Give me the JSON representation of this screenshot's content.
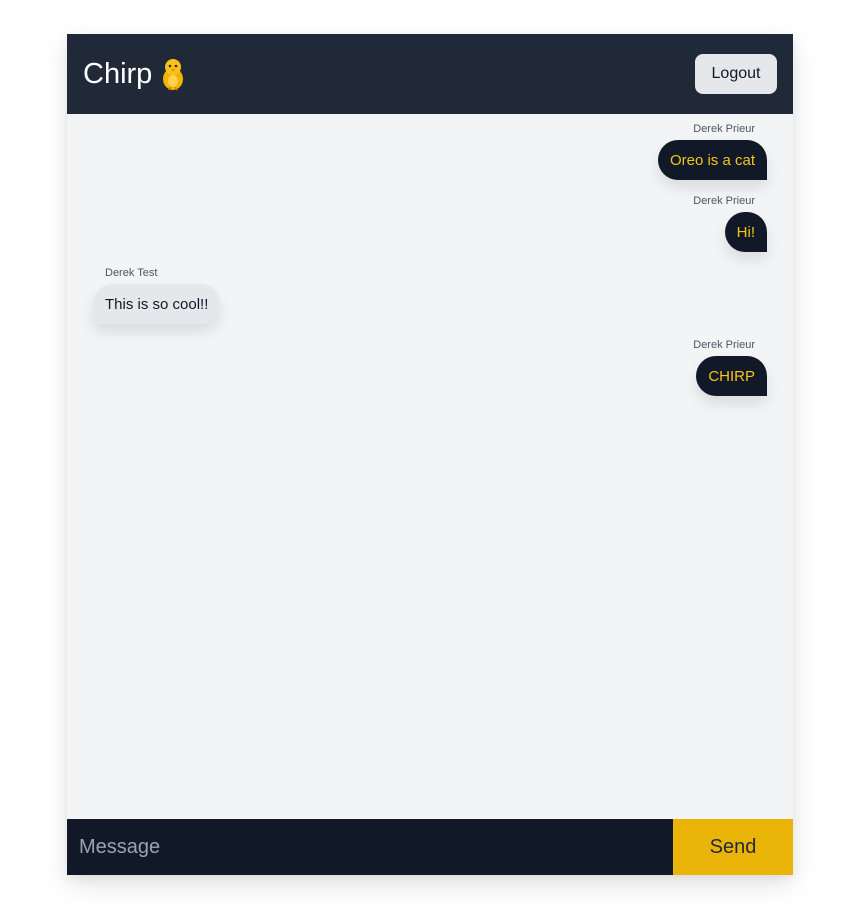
{
  "header": {
    "brand": "Chirp",
    "logout_label": "Logout"
  },
  "messages": [
    {
      "sender": "Derek Prieur",
      "text": "Oreo is a cat",
      "direction": "out"
    },
    {
      "sender": "Derek Prieur",
      "text": "Hi!",
      "direction": "out"
    },
    {
      "sender": "Derek Test",
      "text": "This is so cool!!",
      "direction": "in"
    },
    {
      "sender": "Derek Prieur",
      "text": "CHIRP",
      "direction": "out"
    }
  ],
  "composer": {
    "placeholder": "Message",
    "value": "",
    "send_label": "Send"
  },
  "icons": {
    "brand": "chick-icon"
  },
  "colors": {
    "header_bg": "#1f2937",
    "outgoing_bubble": "#111827",
    "outgoing_text": "#f5c518",
    "incoming_bubble": "#e5e7eb",
    "send_button": "#eab308"
  }
}
